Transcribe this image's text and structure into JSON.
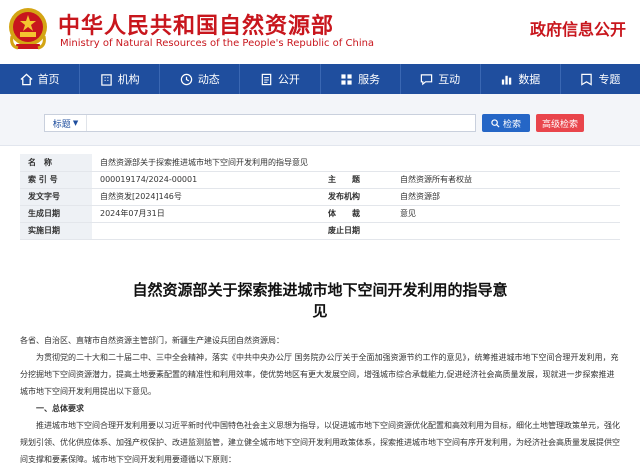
{
  "header": {
    "title_zh": "中华人民共和国自然资源部",
    "title_en": "Ministry of Natural Resources of the People's Republic of China",
    "disclosure": "政府信息公开",
    "emblem_icon": "national-emblem-icon"
  },
  "nav": [
    {
      "label": "首页",
      "icon": "home-icon"
    },
    {
      "label": "机构",
      "icon": "building-icon"
    },
    {
      "label": "动态",
      "icon": "news-icon"
    },
    {
      "label": "公开",
      "icon": "document-icon"
    },
    {
      "label": "服务",
      "icon": "grid-icon"
    },
    {
      "label": "互动",
      "icon": "chat-icon"
    },
    {
      "label": "数据",
      "icon": "bar-chart-icon"
    },
    {
      "label": "专题",
      "icon": "topic-icon"
    }
  ],
  "search": {
    "type_label": "标题",
    "value": "",
    "search_label": "检索",
    "advanced_label": "高级检索"
  },
  "meta": {
    "name_key": "名　称",
    "name_value": "自然资源部关于探索推进城市地下空间开发利用的指导意见",
    "index_key": "索 引 号",
    "index_value": "000019174/2024-00001",
    "topic_key": "主　　题",
    "topic_value": "自然资源所有者权益",
    "doc_no_key": "发文字号",
    "doc_no_value": "自然资发[2024]146号",
    "org_key": "发布机构",
    "org_value": "自然资源部",
    "date_key": "生成日期",
    "date_value": "2024年07月31日",
    "genre_key": "体　　裁",
    "genre_value": "意见",
    "impl_key": "实施日期",
    "impl_value": "",
    "repeal_key": "废止日期",
    "repeal_value": ""
  },
  "document": {
    "title_line1": "自然资源部关于探索推进城市地下空间开发利用的指导意",
    "title_line2": "见",
    "salutation": "各省、自治区、直辖市自然资源主管部门，新疆生产建设兵团自然资源局：",
    "intro": "为贯彻党的二十大和二十届二中、三中全会精神，落实《中共中央办公厅 国务院办公厅关于全面加强资源节约工作的意见》，统筹推进城市地下空间合理开发利用，充分挖掘地下空间资源潜力，提高土地要素配置的精准性和利用效率，使优势地区有更大发展空间，增强城市综合承载能力,促进经济社会高质量发展，现就进一步探索推进城市地下空间开发利用提出以下意见。",
    "section1_head": "一、总体要求",
    "section1_text": "推进城市地下空间合理开发利用要以习近平新时代中国特色社会主义思想为指导，以促进城市地下空间资源优化配置和高效利用为目标，细化土地管理政策单元，强化规划引领、优化供应体系、加强产权保护、改进监测监管，建立健全城市地下空间开发利用政策体系，探索推进城市地下空间有序开发利用，为经济社会高质量发展提供空间支撑和要素保障。城市地下空间开发利用要遵循以下原则："
  },
  "colors": {
    "brand_red": "#c8161d",
    "nav_blue": "#1f4e9e",
    "search_blue": "#2566c6",
    "advanced_red": "#e9454c"
  }
}
